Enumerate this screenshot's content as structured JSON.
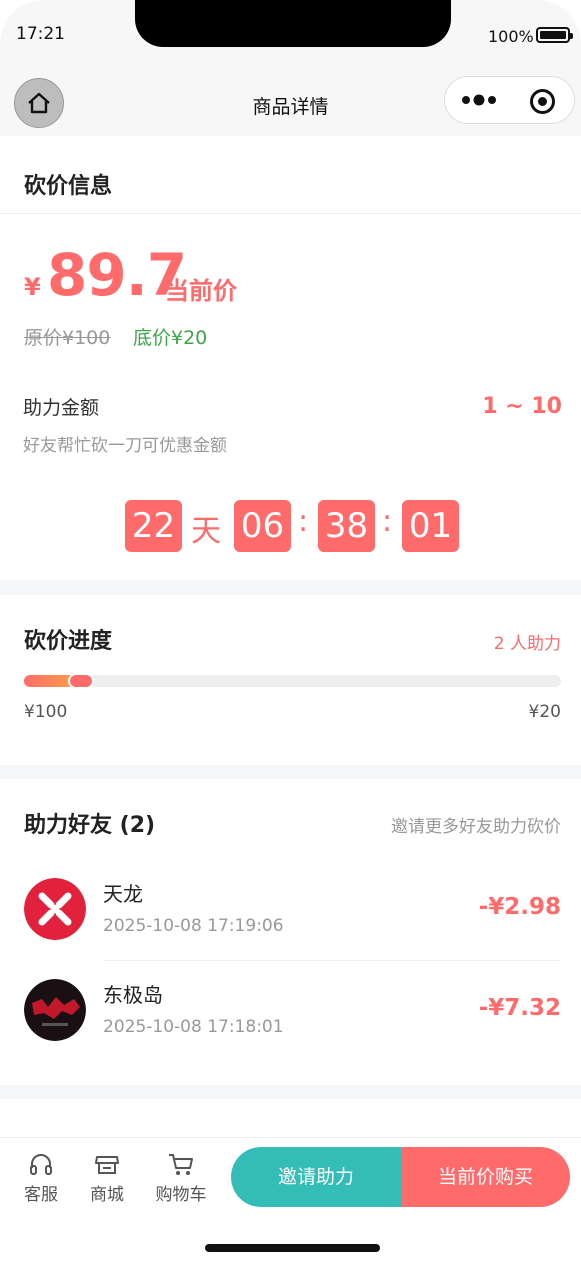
{
  "status_bar": {
    "time": "17:21",
    "battery": "100%"
  },
  "navbar": {
    "title": "商品详情"
  },
  "bargain_info": {
    "title": "砍价信息",
    "currency": "¥",
    "current_price": "89.7",
    "current_price_label": "当前价",
    "original_price": "原价¥100",
    "floor_price": "底价¥20",
    "help_amount_label": "助力金额",
    "help_amount_desc": "好友帮忙砍一刀可优惠金额",
    "help_amount_range": "1 ~ 10"
  },
  "countdown": {
    "days": "22",
    "days_unit": "天",
    "hours": "06",
    "minutes": "38",
    "seconds": "01",
    "separator": ":"
  },
  "progress": {
    "title": "砍价进度",
    "helper_count": "2 人助力",
    "start_label": "¥100",
    "end_label": "¥20",
    "progress_fraction": 0.13
  },
  "friends": {
    "title": "助力好友 (2)",
    "invite_more": "邀请更多好友助力砍价",
    "items": [
      {
        "name": "天龙",
        "time": "2025-10-08 17:19:06",
        "amount": "-¥2.98"
      },
      {
        "name": "东极岛",
        "time": "2025-10-08 17:18:01",
        "amount": "-¥7.32"
      }
    ]
  },
  "bottom_bar": {
    "tabs": [
      {
        "label": "客服",
        "icon": "headset-icon"
      },
      {
        "label": "商城",
        "icon": "store-icon"
      },
      {
        "label": "购物车",
        "icon": "cart-icon"
      }
    ],
    "invite_button": "邀请助力",
    "buy_button": "当前价购买"
  },
  "colors": {
    "accent": "#ff6b6b",
    "teal": "#33bdb6",
    "green": "#3fa54a"
  }
}
